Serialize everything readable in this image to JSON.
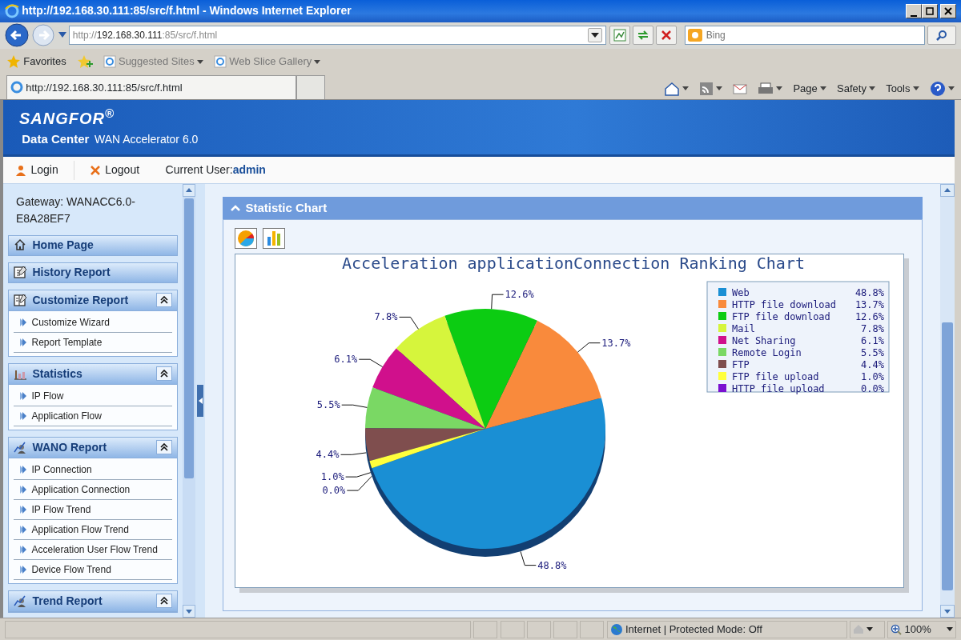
{
  "browser": {
    "title": "http://192.168.30.111:85/src/f.html - Windows Internet Explorer",
    "address": {
      "scheme": "http://",
      "host": "192.168.30.111",
      "rest": ":85/src/f.html"
    },
    "search": {
      "placeholder": "Bing"
    },
    "favorites": "Favorites",
    "favorite_links": [
      "Suggested Sites",
      "Web Slice Gallery"
    ],
    "tab": {
      "title": "http://192.168.30.111:85/src/f.html"
    },
    "commands": [
      "Page",
      "Safety",
      "Tools"
    ],
    "status_bar": {
      "zone": "Internet | Protected Mode: Off",
      "zoom": "100%"
    }
  },
  "app": {
    "brand": "SANGFOR$^{®}$",
    "subtitle": "Data Center",
    "product": "WAN Accelerator 6.0",
    "toolbar": {
      "login": "Login",
      "logout": "Logout",
      "user_label": "Current User:",
      "user": "admin"
    },
    "sidebar": {
      "gateway": "Gateway: WANACC6.0-E8A28EF7",
      "sections": [
        {
          "label": "Home Page",
          "kind": "link"
        },
        {
          "label": "History Report",
          "kind": "link"
        },
        {
          "label": "Customize Report",
          "kind": "group",
          "expanded": true,
          "items": [
            "Customize Wizard",
            "Report Template"
          ]
        },
        {
          "label": "Statistics",
          "kind": "group",
          "expanded": true,
          "items": [
            "IP Flow",
            "Application Flow"
          ]
        },
        {
          "label": "WANO Report",
          "kind": "group",
          "expanded": true,
          "items": [
            "IP Connection",
            "Application Connection",
            "IP Flow Trend",
            "Application Flow Trend",
            "Acceleration User Flow Trend",
            "Device Flow Trend"
          ]
        },
        {
          "label": "Trend Report",
          "kind": "group",
          "expanded": true
        }
      ]
    },
    "panel": {
      "title": "Statistic Chart",
      "chart_data": {
        "type": "pie",
        "title": "Acceleration applicationConnection Ranking Chart",
        "categories": [
          "Web",
          "HTTP file download",
          "FTP file download",
          "Mail",
          "Net Sharing",
          "Remote Login",
          "FTP",
          "FTP file upload",
          "HTTP file upload"
        ],
        "series": [
          {
            "colors": [
              "#1a8fd4",
              "#f98a3c",
              "#0ccc12",
              "#d6f53c",
              "#d0108c",
              "#7ad864",
              "#7f4e4e",
              "#ffff3c",
              "#7a10d0"
            ],
            "values": [
              48.8,
              13.7,
              12.6,
              7.8,
              6.1,
              5.5,
              4.4,
              1.0,
              0.0
            ]
          }
        ],
        "legend": "right",
        "value_labels": [
          "48.8%",
          "13.7%",
          "12.6%",
          "7.8%",
          "6.1%",
          "5.5%",
          "4.4%",
          "1.0%",
          "0.0%"
        ]
      },
      "legend_values": [
        "48.8%",
        "13.7%",
        "12.6%",
        "7.8%",
        "6.1%",
        "5.5%",
        "4.4%",
        "1.0%",
        "0.0%"
      ]
    }
  }
}
